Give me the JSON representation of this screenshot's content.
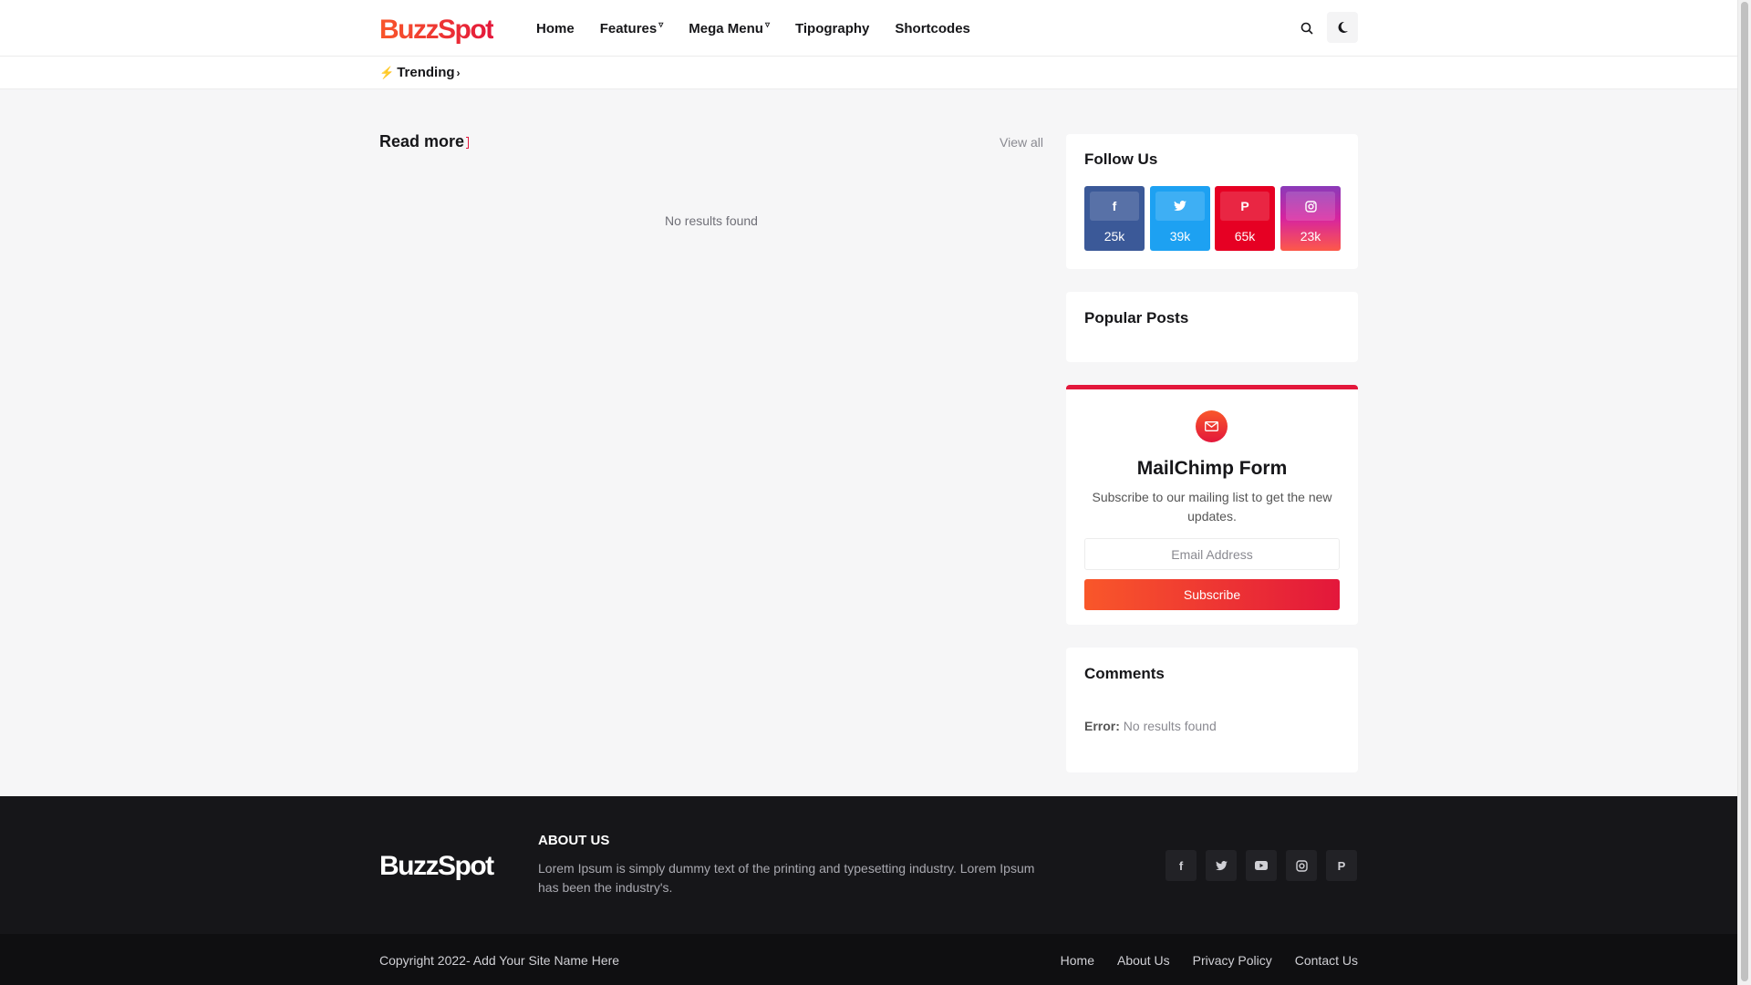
{
  "header": {
    "logo_text": "BuzzSpot",
    "nav": [
      {
        "label": "Home",
        "has_dropdown": false
      },
      {
        "label": "Features",
        "has_dropdown": true
      },
      {
        "label": "Mega Menu",
        "has_dropdown": true
      },
      {
        "label": "Tipography",
        "has_dropdown": false
      },
      {
        "label": "Shortcodes",
        "has_dropdown": false
      }
    ],
    "search_icon": "search-icon",
    "dark_mode_icon": "moon-icon"
  },
  "trending": {
    "label": "Trending"
  },
  "main": {
    "section_title": "Read more",
    "view_all": "View all",
    "empty_message": "No results found"
  },
  "sidebar": {
    "follow": {
      "title": "Follow Us",
      "networks": [
        {
          "name": "facebook",
          "count": "25k",
          "color": "#3b5998"
        },
        {
          "name": "twitter",
          "count": "39k",
          "color": "#1da1f2"
        },
        {
          "name": "pinterest",
          "count": "65k",
          "color": "#e60023"
        },
        {
          "name": "instagram",
          "count": "23k",
          "color": "#c13584"
        }
      ]
    },
    "popular": {
      "title": "Popular Posts"
    },
    "mailchimp": {
      "title": "MailChimp Form",
      "description": "Subscribe to our mailing list to get the new updates.",
      "email_placeholder": "Email Address",
      "button_label": "Subscribe"
    },
    "comments": {
      "title": "Comments",
      "error_label": "Error:",
      "error_text": " No results found"
    }
  },
  "footer": {
    "logo_text": "BuzzSpot",
    "about_title": "ABOUT US",
    "about_text": "Lorem Ipsum is simply dummy text of the printing and typesetting industry. Lorem Ipsum has been the industry's.",
    "social_icons": [
      "facebook-icon",
      "twitter-icon",
      "youtube-icon",
      "instagram-icon",
      "pinterest-icon"
    ],
    "copyright": "Copyright 2022- Add Your Site Name Here",
    "links": [
      "Home",
      "About Us",
      "Privacy Policy",
      "Contact Us"
    ]
  },
  "colors": {
    "accent": "#e3173b",
    "accent_start": "#f9572a",
    "footer_bg": "#161619"
  }
}
